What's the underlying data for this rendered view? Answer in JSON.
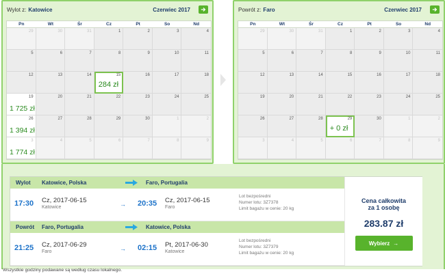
{
  "outbound_calendar": {
    "label": "Wylot z:",
    "city": "Katowice",
    "month": "Czerwiec 2017",
    "weekdays": [
      "Pn",
      "Wt",
      "Śr",
      "Cz",
      "Pt",
      "So",
      "Nd"
    ],
    "cells": [
      {
        "day": "29",
        "other": true
      },
      {
        "day": "30",
        "other": true
      },
      {
        "day": "31",
        "other": true
      },
      {
        "day": "1"
      },
      {
        "day": "2"
      },
      {
        "day": "3"
      },
      {
        "day": "4"
      },
      {
        "day": "5"
      },
      {
        "day": "6"
      },
      {
        "day": "7"
      },
      {
        "day": "8"
      },
      {
        "day": "9"
      },
      {
        "day": "10"
      },
      {
        "day": "11"
      },
      {
        "day": "12"
      },
      {
        "day": "13"
      },
      {
        "day": "14"
      },
      {
        "day": "15",
        "price": "284 zł",
        "selected": true
      },
      {
        "day": "16"
      },
      {
        "day": "17"
      },
      {
        "day": "18"
      },
      {
        "day": "19",
        "price": "1 725 zł"
      },
      {
        "day": "20"
      },
      {
        "day": "21"
      },
      {
        "day": "22"
      },
      {
        "day": "23"
      },
      {
        "day": "24"
      },
      {
        "day": "25"
      },
      {
        "day": "26",
        "price": "1 394 zł"
      },
      {
        "day": "27"
      },
      {
        "day": "28"
      },
      {
        "day": "29"
      },
      {
        "day": "30"
      },
      {
        "day": "1",
        "other": true
      },
      {
        "day": "2",
        "other": true
      },
      {
        "day": "3",
        "other": true,
        "price": "1 774 zł"
      },
      {
        "day": "4",
        "other": true
      },
      {
        "day": "5",
        "other": true
      },
      {
        "day": "6",
        "other": true
      },
      {
        "day": "7",
        "other": true
      },
      {
        "day": "8",
        "other": true
      },
      {
        "day": "9",
        "other": true
      }
    ]
  },
  "return_calendar": {
    "label": "Powrót z:",
    "city": "Faro",
    "month": "Czerwiec 2017",
    "weekdays": [
      "Pn",
      "Wt",
      "Śr",
      "Cz",
      "Pt",
      "So",
      "Nd"
    ],
    "cells": [
      {
        "day": "29",
        "other": true
      },
      {
        "day": "30",
        "other": true
      },
      {
        "day": "31",
        "other": true
      },
      {
        "day": "1"
      },
      {
        "day": "2"
      },
      {
        "day": "3"
      },
      {
        "day": "4"
      },
      {
        "day": "5"
      },
      {
        "day": "6"
      },
      {
        "day": "7"
      },
      {
        "day": "8"
      },
      {
        "day": "9"
      },
      {
        "day": "10"
      },
      {
        "day": "11"
      },
      {
        "day": "12"
      },
      {
        "day": "13"
      },
      {
        "day": "14"
      },
      {
        "day": "15"
      },
      {
        "day": "16"
      },
      {
        "day": "17"
      },
      {
        "day": "18"
      },
      {
        "day": "19"
      },
      {
        "day": "20"
      },
      {
        "day": "21"
      },
      {
        "day": "22"
      },
      {
        "day": "23"
      },
      {
        "day": "24"
      },
      {
        "day": "25"
      },
      {
        "day": "26"
      },
      {
        "day": "27"
      },
      {
        "day": "28"
      },
      {
        "day": "29",
        "price": "+ 0 zł",
        "selected": true
      },
      {
        "day": "30"
      },
      {
        "day": "1",
        "other": true
      },
      {
        "day": "2",
        "other": true
      },
      {
        "day": "3",
        "other": true
      },
      {
        "day": "4",
        "other": true
      },
      {
        "day": "5",
        "other": true
      },
      {
        "day": "6",
        "other": true
      },
      {
        "day": "7",
        "other": true
      },
      {
        "day": "8",
        "other": true
      },
      {
        "day": "9",
        "other": true
      }
    ]
  },
  "outbound": {
    "kind": "Wylot",
    "from": "Katowice, Polska",
    "to": "Faro, Portugalia",
    "dep_time": "17:30",
    "dep_date": "Cz, 2017-06-15",
    "dep_city": "Katowice",
    "arr_time": "20:35",
    "arr_date": "Cz, 2017-06-15",
    "arr_city": "Faro",
    "info1": "Lot bezpośredni",
    "info2": "Numer lotu: 3Z7378",
    "info3": "Limit bagażu w cenie: 20 kg"
  },
  "return": {
    "kind": "Powrót",
    "from": "Faro, Portugalia",
    "to": "Katowice, Polska",
    "dep_time": "21:25",
    "dep_date": "Cz, 2017-06-29",
    "dep_city": "Faro",
    "arr_time": "02:15",
    "arr_date": "Pt, 2017-06-30",
    "arr_city": "Katowice",
    "info1": "Lot bezpośredni",
    "info2": "Numer lotu: 3Z7379",
    "info3": "Limit bagażu w cenie: 20 kg"
  },
  "total": {
    "label1": "Cena całkowita",
    "label2": "za 1 osobę",
    "amount": "283.87 zł",
    "button": "Wybierz"
  },
  "footnote": "Wszystkie godziny podawane są według czasu lokalnego.",
  "colors": {
    "accent_green": "#58b32c",
    "price_green": "#2a8a1e",
    "time_blue": "#1c72c9",
    "panel_bg": "#e3f3d4"
  }
}
